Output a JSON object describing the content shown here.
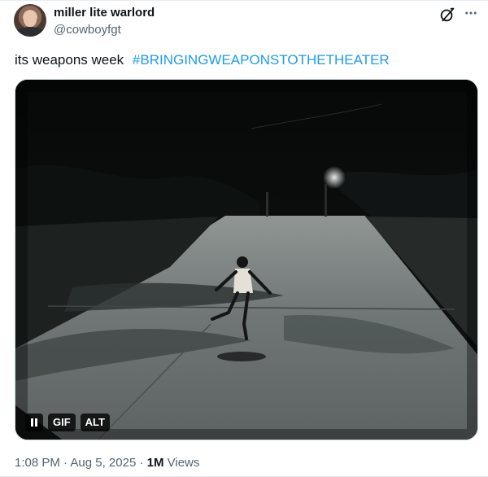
{
  "author": {
    "display_name": "miller lite warlord",
    "handle": "@cowboyfgt"
  },
  "header_icons": [
    "grok-icon",
    "more-options-icon"
  ],
  "tweet": {
    "text": "its weapons week ",
    "hashtag": "#BRINGINGWEAPONSTOTHETHEATER"
  },
  "media": {
    "type": "gif",
    "controls": {
      "pause_icon": "pause-icon",
      "gif_label": "GIF",
      "alt_label": "ALT"
    }
  },
  "meta": {
    "time": "1:08 PM",
    "separator": " · ",
    "date": "Aug 5, 2025",
    "views_count": "1M",
    "views_label": " Views"
  },
  "colors": {
    "link": "#1d9bf0",
    "secondary_text": "#536471",
    "primary_text": "#0f1419"
  }
}
